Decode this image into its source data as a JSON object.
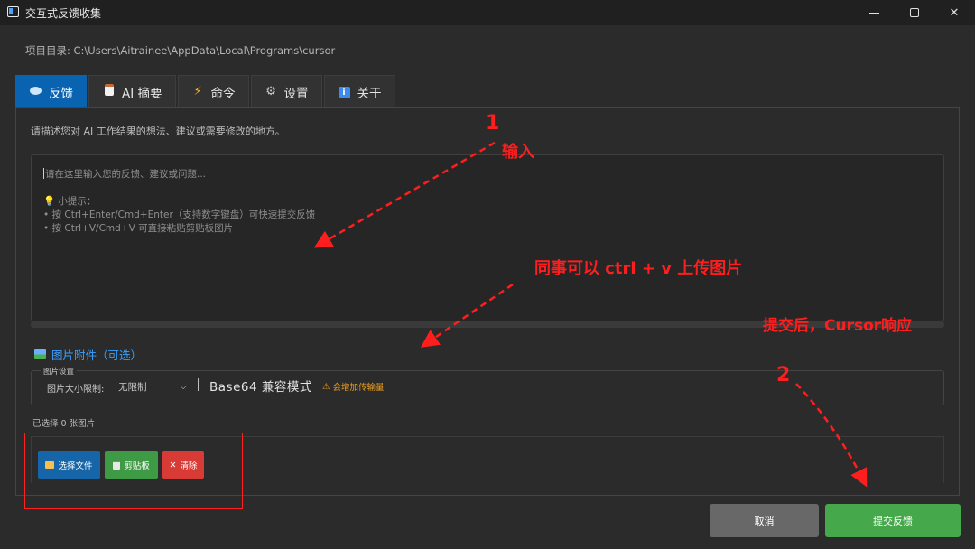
{
  "window": {
    "title": "交互式反馈收集",
    "minimize_glyph": "",
    "close_glyph": "✕"
  },
  "project_dir": "项目目录: C:\\Users\\Aitrainee\\AppData\\Local\\Programs\\cursor",
  "tabs": [
    {
      "label": "反馈",
      "icon": "speech-bubble-icon",
      "active": true
    },
    {
      "label": "AI 摘要",
      "icon": "clipboard-icon",
      "active": false
    },
    {
      "label": "命令",
      "icon": "lightning-icon",
      "active": false
    },
    {
      "label": "设置",
      "icon": "gear-icon",
      "active": false
    },
    {
      "label": "关于",
      "icon": "info-icon",
      "active": false
    }
  ],
  "feedback": {
    "description": "请描述您对 AI 工作结果的想法、建议或需要修改的地方。",
    "placeholder": {
      "line1": "请在这里输入您的反馈、建议或问题...",
      "tip_title": "小提示：",
      "tip1": "• 按 Ctrl+Enter/Cmd+Enter（支持数字键盘）可快速提交反馈",
      "tip2": "• 按 Ctrl+V/Cmd+V 可直接粘贴剪贴板图片"
    }
  },
  "attachments": {
    "title": "图片附件（可选）",
    "settings_legend": "图片设置",
    "size_limit_label": "图片大小限制:",
    "size_limit_value": "无限制",
    "base64_label": "Base64 兼容模式",
    "warning": "会增加传输量",
    "selected_count": "已选择 0 张图片",
    "buttons": {
      "select_file": "选择文件",
      "clipboard": "剪贴板",
      "clear": "清除"
    }
  },
  "actions": {
    "cancel": "取消",
    "submit": "提交反馈"
  },
  "annotations": {
    "num1": "1",
    "input": "输入",
    "paste": "同事可以 ctrl + v 上传图片",
    "after_submit": "提交后，Cursor响应",
    "num2": "2"
  },
  "colors": {
    "accent": "#0a63b0",
    "submit": "#45a84a",
    "cancel": "#686868",
    "danger": "#d83a35",
    "annotation": "#ff1e1e"
  }
}
